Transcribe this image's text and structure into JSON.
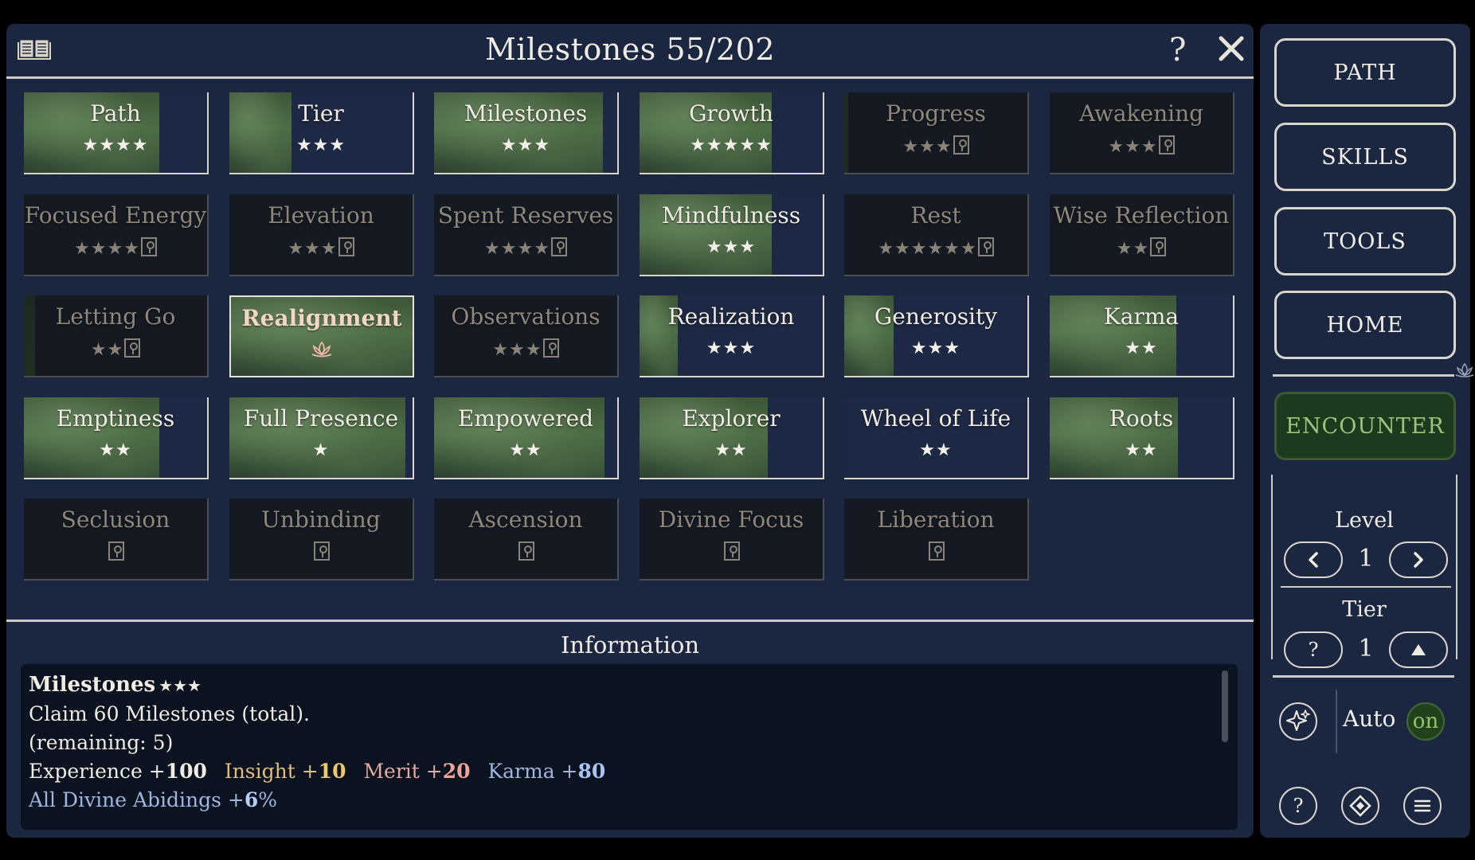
{
  "window": {
    "title": "Milestones 55/202",
    "help_label": "?"
  },
  "milestones": [
    {
      "name": "Path",
      "stars": "★★★★",
      "state": "unlocked",
      "progress": 0.74
    },
    {
      "name": "Tier",
      "stars": "★★★",
      "state": "unlocked",
      "progress": 0.34
    },
    {
      "name": "Milestones",
      "stars": "★★★",
      "state": "unlocked",
      "progress": 0.92
    },
    {
      "name": "Growth",
      "stars": "★★★★★",
      "state": "unlocked",
      "progress": 0.72
    },
    {
      "name": "Progress",
      "stars": "★★★",
      "state": "locked",
      "progress": 0.02
    },
    {
      "name": "Awakening",
      "stars": "★★★",
      "state": "locked",
      "progress": 0
    },
    {
      "name": "Focused Energy",
      "stars": "★★★★",
      "state": "locked",
      "progress": 0
    },
    {
      "name": "Elevation",
      "stars": "★★★",
      "state": "locked",
      "progress": 0
    },
    {
      "name": "Spent Reserves",
      "stars": "★★★★",
      "state": "locked",
      "progress": 0
    },
    {
      "name": "Mindfulness",
      "stars": "★★★",
      "state": "unlocked",
      "progress": 0.72
    },
    {
      "name": "Rest",
      "stars": "★★★★★★",
      "state": "locked",
      "progress": 0
    },
    {
      "name": "Wise Reflection",
      "stars": "★★",
      "state": "locked",
      "progress": 0
    },
    {
      "name": "Letting Go",
      "stars": "★★",
      "state": "locked",
      "progress": 0.06
    },
    {
      "name": "Realignment",
      "stars": "",
      "state": "active",
      "progress": 1
    },
    {
      "name": "Observations",
      "stars": "★★★",
      "state": "locked",
      "progress": 0
    },
    {
      "name": "Realization",
      "stars": "★★★",
      "state": "unlocked",
      "progress": 0.21
    },
    {
      "name": "Generosity",
      "stars": "★★★",
      "state": "unlocked",
      "progress": 0.27
    },
    {
      "name": "Karma",
      "stars": "★★",
      "state": "unlocked",
      "progress": 0.69
    },
    {
      "name": "Emptiness",
      "stars": "★★",
      "state": "unlocked",
      "progress": 0.74
    },
    {
      "name": "Full Presence",
      "stars": "★",
      "state": "unlocked",
      "progress": 0.96
    },
    {
      "name": "Empowered",
      "stars": "★★",
      "state": "unlocked",
      "progress": 0.93
    },
    {
      "name": "Explorer",
      "stars": "★★",
      "state": "unlocked",
      "progress": 0.7
    },
    {
      "name": "Wheel of Life",
      "stars": "★★",
      "state": "unlocked",
      "progress": 0
    },
    {
      "name": "Roots",
      "stars": "★★",
      "state": "unlocked",
      "progress": 0.7
    },
    {
      "name": "Seclusion",
      "stars": "",
      "state": "locked",
      "progress": 0
    },
    {
      "name": "Unbinding",
      "stars": "",
      "state": "locked",
      "progress": 0
    },
    {
      "name": "Ascension",
      "stars": "",
      "state": "locked",
      "progress": 0
    },
    {
      "name": "Divine Focus",
      "stars": "",
      "state": "locked",
      "progress": 0
    },
    {
      "name": "Liberation",
      "stars": "",
      "state": "locked",
      "progress": 0
    }
  ],
  "information": {
    "heading": "Information",
    "title": "Milestones",
    "title_stars": "★★★",
    "description": "Claim 60 Milestones (total).",
    "remaining": "(remaining: 5)",
    "rewards": {
      "experience_label": "Experience +",
      "experience_value": "100",
      "insight_label": "Insight +",
      "insight_value": "10",
      "merit_label": "Merit +",
      "merit_value": "20",
      "karma_label": "Karma +",
      "karma_value": "80"
    },
    "bonus_label": "All Divine Abidings +",
    "bonus_value": "6",
    "bonus_unit": "%"
  },
  "sidebar": {
    "nav": [
      "PATH",
      "SKILLS",
      "TOOLS",
      "HOME"
    ],
    "encounter": "ENCOUNTER",
    "level_label": "Level",
    "level_value": "1",
    "tier_label": "Tier",
    "tier_value": "1",
    "tier_help": "?",
    "auto_label": "Auto",
    "auto_state": "on",
    "help_label": "?"
  },
  "colors": {
    "panel": "#1b2640",
    "progress_green": "#4b6a44",
    "encounter_green": "#9cc47c",
    "insight": "#e3be7a",
    "merit": "#e6a9a0",
    "karma": "#9fb6de"
  },
  "icons": [
    "book-icon",
    "close-icon",
    "lock-icon",
    "lotus-icon",
    "chevron-left-icon",
    "chevron-right-icon",
    "triangle-up-icon",
    "sparkle-icon",
    "diamond-icon",
    "menu-icon"
  ]
}
